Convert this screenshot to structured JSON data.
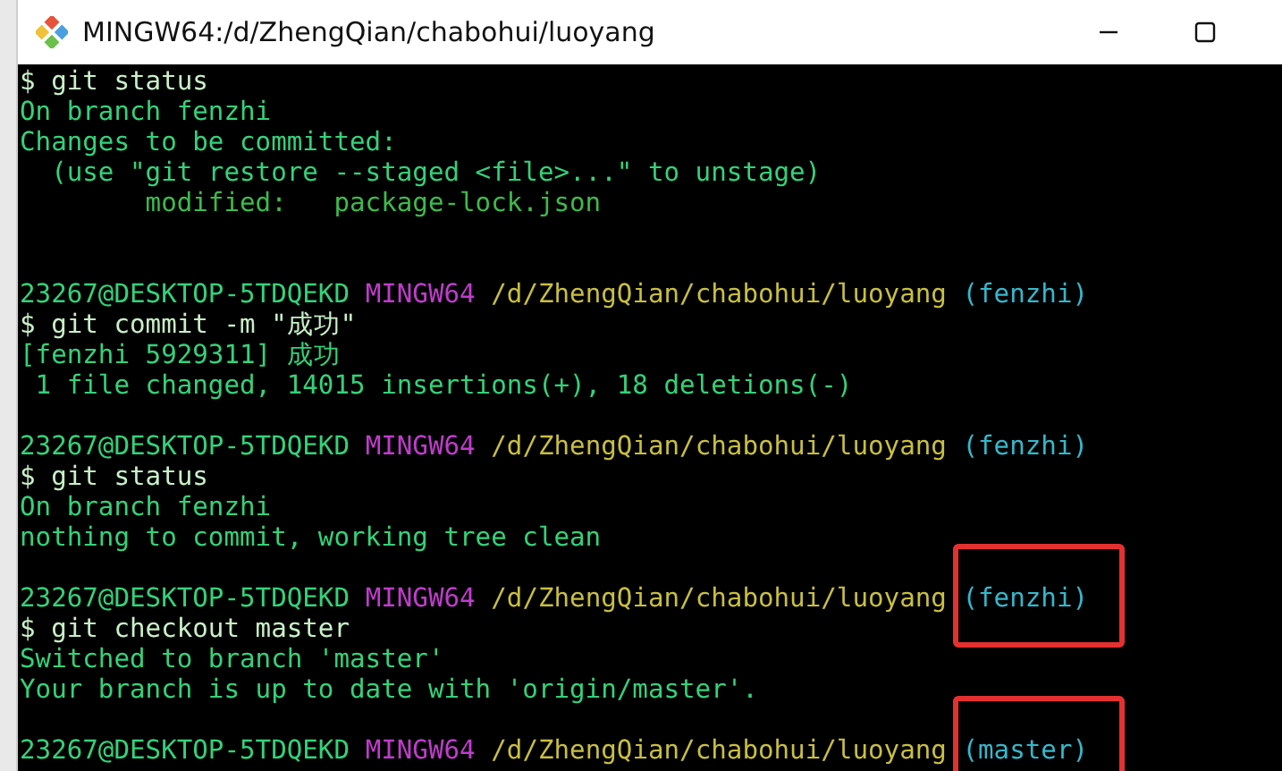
{
  "window": {
    "title": "MINGW64:/d/ZhengQian/chabohui/luoyang"
  },
  "terminal": {
    "lines": [
      {
        "kind": "text",
        "segments": [
          {
            "kind": "command",
            "text": "$ git status"
          }
        ]
      },
      {
        "kind": "text",
        "segments": [
          {
            "kind": "output",
            "text": "On branch fenzhi"
          }
        ]
      },
      {
        "kind": "text",
        "segments": [
          {
            "kind": "output",
            "text": "Changes to be committed:"
          }
        ]
      },
      {
        "kind": "text",
        "segments": [
          {
            "kind": "output",
            "text": "  (use \"git restore --staged <file>...\" to unstage)"
          }
        ]
      },
      {
        "kind": "text",
        "segments": [
          {
            "kind": "modified",
            "text": "        modified:   package-lock.json"
          }
        ]
      },
      {
        "kind": "blank"
      },
      {
        "kind": "blank"
      },
      {
        "kind": "text",
        "segments": [
          {
            "kind": "user",
            "text": "23267@DESKTOP-5TDQEKD"
          },
          {
            "kind": "system",
            "text": "MINGW64"
          },
          {
            "kind": "path",
            "text": "/d/ZhengQian/chabohui/luoyang"
          },
          {
            "kind": "branch",
            "text": "(fenzhi)",
            "highlighted": false
          }
        ]
      },
      {
        "kind": "text",
        "segments": [
          {
            "kind": "command",
            "text": "$ git commit -m \"成功\""
          }
        ]
      },
      {
        "kind": "text",
        "segments": [
          {
            "kind": "output",
            "text": "[fenzhi 5929311] 成功"
          }
        ]
      },
      {
        "kind": "text",
        "segments": [
          {
            "kind": "output",
            "text": " 1 file changed, 14015 insertions(+), 18 deletions(-)"
          }
        ]
      },
      {
        "kind": "blank"
      },
      {
        "kind": "text",
        "segments": [
          {
            "kind": "user",
            "text": "23267@DESKTOP-5TDQEKD"
          },
          {
            "kind": "system",
            "text": "MINGW64"
          },
          {
            "kind": "path",
            "text": "/d/ZhengQian/chabohui/luoyang"
          },
          {
            "kind": "branch",
            "text": "(fenzhi)",
            "highlighted": false
          }
        ]
      },
      {
        "kind": "text",
        "segments": [
          {
            "kind": "command",
            "text": "$ git status"
          }
        ]
      },
      {
        "kind": "text",
        "segments": [
          {
            "kind": "output",
            "text": "On branch fenzhi"
          }
        ]
      },
      {
        "kind": "text",
        "segments": [
          {
            "kind": "output",
            "text": "nothing to commit, working tree clean"
          }
        ]
      },
      {
        "kind": "blank"
      },
      {
        "kind": "text",
        "segments": [
          {
            "kind": "user",
            "text": "23267@DESKTOP-5TDQEKD"
          },
          {
            "kind": "system",
            "text": "MINGW64"
          },
          {
            "kind": "path",
            "text": "/d/ZhengQian/chabohui/luoyang"
          },
          {
            "kind": "branch",
            "text": "(fenzhi)",
            "highlighted": true
          }
        ]
      },
      {
        "kind": "text",
        "segments": [
          {
            "kind": "command",
            "text": "$ git checkout master"
          }
        ]
      },
      {
        "kind": "text",
        "segments": [
          {
            "kind": "output",
            "text": "Switched to branch 'master'"
          }
        ]
      },
      {
        "kind": "text",
        "segments": [
          {
            "kind": "output",
            "text": "Your branch is up to date with 'origin/master'."
          }
        ]
      },
      {
        "kind": "blank"
      },
      {
        "kind": "text",
        "segments": [
          {
            "kind": "user",
            "text": "23267@DESKTOP-5TDQEKD"
          },
          {
            "kind": "system",
            "text": "MINGW64"
          },
          {
            "kind": "path",
            "text": "/d/ZhengQian/chabohui/luoyang"
          },
          {
            "kind": "branch",
            "text": "(master)",
            "highlighted": true
          }
        ]
      }
    ]
  }
}
